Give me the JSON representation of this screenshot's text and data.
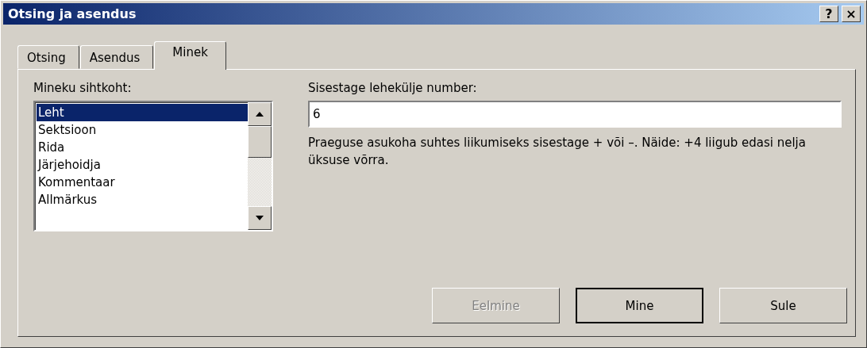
{
  "window": {
    "title": "Otsing ja asendus",
    "title_buttons": [
      {
        "kind": "help",
        "label": "?"
      },
      {
        "kind": "close",
        "label": "×"
      }
    ]
  },
  "tabs": [
    {
      "label": "Otsing",
      "selected": false
    },
    {
      "label": "Asendus",
      "selected": false
    },
    {
      "label": "Minek",
      "selected": true
    }
  ],
  "target_list": {
    "label": "Mineku sihtkoht:",
    "items": [
      {
        "label": "Leht",
        "selected": true
      },
      {
        "label": "Sektsioon",
        "selected": false
      },
      {
        "label": "Rida",
        "selected": false
      },
      {
        "label": "Järjehoidja",
        "selected": false
      },
      {
        "label": "Kommentaar",
        "selected": false
      },
      {
        "label": "Allmärkus",
        "selected": false
      }
    ]
  },
  "page_input": {
    "label": "Sisestage lehekülje number:",
    "value": "6"
  },
  "hint": "Praeguse asukoha suhtes liikumiseks sisestage + või –. Näide: +4 liigub edasi nelja üksuse võrra.",
  "buttons": [
    {
      "label": "Eelmine",
      "disabled": true,
      "default": false
    },
    {
      "label": "Mine",
      "disabled": false,
      "default": true
    },
    {
      "label": "Sule",
      "disabled": false,
      "default": false
    }
  ]
}
